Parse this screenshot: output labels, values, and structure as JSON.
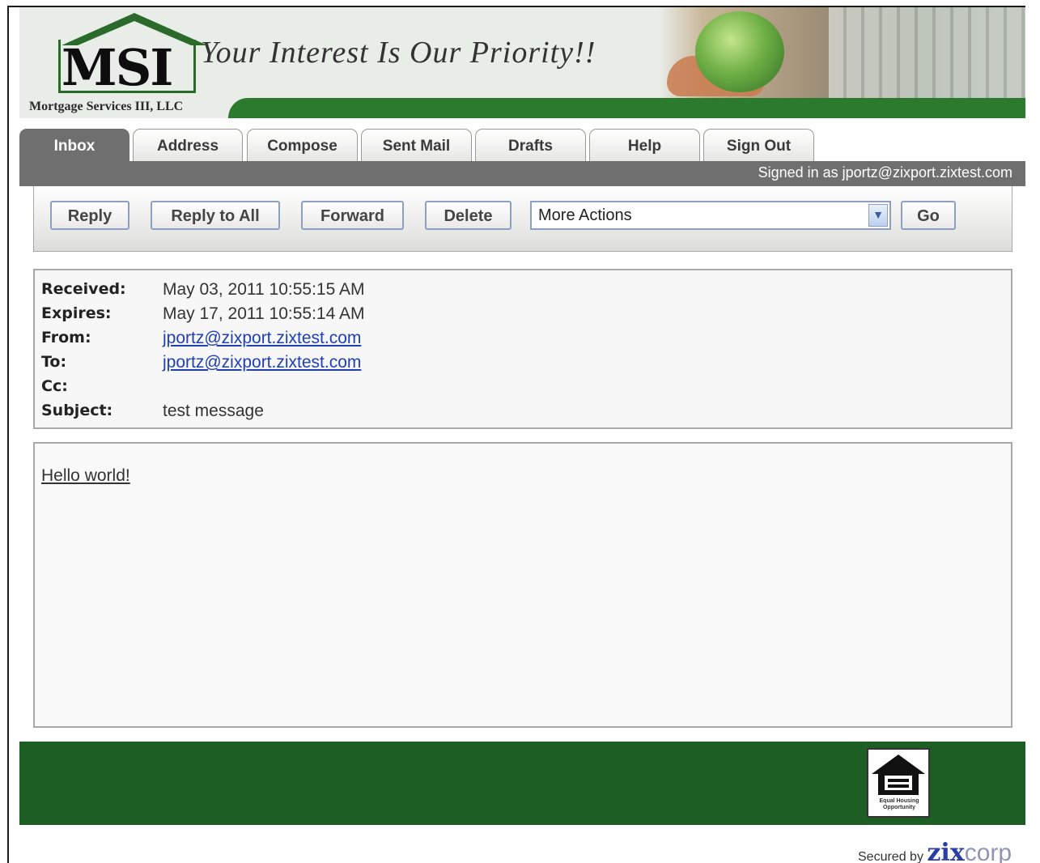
{
  "header": {
    "logo_text": "MSI",
    "company_name": "Mortgage Services III, LLC",
    "tagline": "Your Interest Is Our Priority!!"
  },
  "tabs": [
    {
      "label": "Inbox",
      "active": true
    },
    {
      "label": "Address",
      "active": false
    },
    {
      "label": "Compose",
      "active": false
    },
    {
      "label": "Sent Mail",
      "active": false
    },
    {
      "label": "Drafts",
      "active": false
    },
    {
      "label": "Help",
      "active": false
    },
    {
      "label": "Sign Out",
      "active": false
    }
  ],
  "signed_in_text": "Signed in as jportz@zixport.zixtest.com",
  "toolbar": {
    "reply_label": "Reply",
    "reply_all_label": "Reply to All",
    "forward_label": "Forward",
    "delete_label": "Delete",
    "actions_selected": "More Actions",
    "go_label": "Go"
  },
  "message": {
    "received_label": "Received:",
    "received": "May 03, 2011 10:55:15 AM",
    "expires_label": "Expires:",
    "expires": "May 17, 2011 10:55:14 AM",
    "from_label": "From:",
    "from": "jportz@zixport.zixtest.com",
    "to_label": "To:",
    "to": "jportz@zixport.zixtest.com",
    "cc_label": "Cc:",
    "cc": "",
    "subject_label": "Subject:",
    "subject": "test message",
    "body": "Hello world!"
  },
  "footer": {
    "equal_housing_text": "Equal Housing Opportunity",
    "secured_by": "Secured by",
    "zix": "zix",
    "corp": "corp"
  },
  "colors": {
    "brand_green": "#2c7a2e",
    "footer_green": "#1c5e24",
    "tab_gray": "#6f6f6f",
    "link_blue": "#1f3fb4"
  }
}
